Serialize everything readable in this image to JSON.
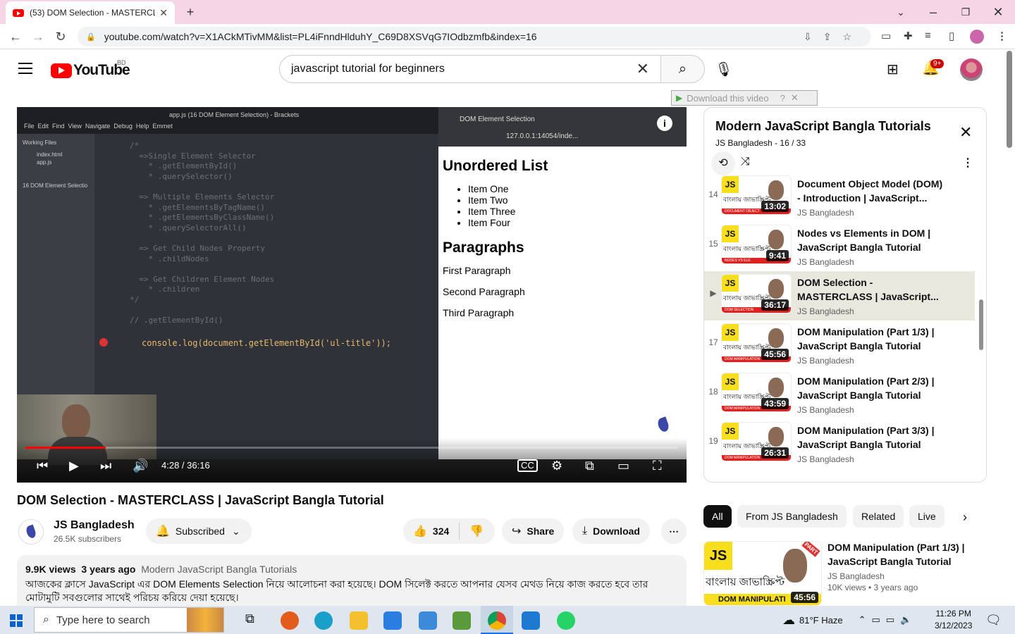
{
  "browser": {
    "tab_title": "(53) DOM Selection - MASTERCLASS | JavaScript Bangla Tutorial",
    "url": "youtube.com/watch?v=X1ACkMTivMM&list=PL4iFnndHlduhY_C69D8XSVqG7IOdbzmfb&index=16"
  },
  "header": {
    "logo_text": "YouTube",
    "country_code": "BD",
    "search_query": "javascript tutorial for beginners",
    "notification_count": "9+"
  },
  "extension": {
    "download_label": "Download this video"
  },
  "player": {
    "current_time": "4:28",
    "duration": "36:16",
    "time_display": "4:28 / 36:16",
    "progress_fraction": 0.123,
    "editor_title": "app.js (16 DOM Element Selection) - Brackets",
    "editor_menu": "File  Edit  Find  View  Navigate  Debug  Help  Emmet",
    "working_files": "Working Files",
    "file1": "index.html",
    "file2": "app.js",
    "project": "16 DOM Element Selectio",
    "code_comment": "/*\n  =>Single Element Selector\n    * .getElementById()\n    * .querySelector()\n\n  => Multiple Elements Selector\n    * .getElementsByTagName()\n    * .getElementsByClassName()\n    * .querySelectorAll()\n\n  => Get Child Nodes Property\n    * .childNodes\n\n  => Get Children Element Nodes\n    * .children\n*/\n\n// .getElementById()",
    "code_line": "console.log(document.getElementById('ul-title'));",
    "preview_tab": "DOM Element Selection",
    "preview_url": "127.0.0.1:14054/inde...",
    "preview": {
      "heading1": "Unordered List",
      "items": [
        "Item One",
        "Item Two",
        "Item Three",
        "Item Four"
      ],
      "heading2": "Paragraphs",
      "paragraphs": [
        "First Paragraph",
        "Second Paragraph",
        "Third Paragraph"
      ]
    }
  },
  "video": {
    "title": "DOM Selection - MASTERCLASS | JavaScript Bangla Tutorial",
    "channel": "JS Bangladesh",
    "subscribers": "26.5K subscribers",
    "subscribed_label": "Subscribed",
    "likes": "324",
    "share_label": "Share",
    "download_label": "Download",
    "views": "9.9K views",
    "age": "3 years ago",
    "playlist_link": "Modern JavaScript Bangla Tutorials",
    "description": "আজকের ক্লাসে JavaScript এর DOM Elements Selection নিয়ে আলোচনা করা হয়েছে। DOM সিলেক্ট করতে আপনার যেসব মেথড নিয়ে কাজ করতে হবে তার মোটামুটি সবগুলোর সাথেই পরিচয় করিয়ে দেয়া হয়েছে।"
  },
  "playlist": {
    "title": "Modern JavaScript Bangla Tutorials",
    "owner": "JS Bangladesh",
    "position": "16 / 33",
    "items": [
      {
        "index": "14",
        "title": "Document Object Model (DOM) - Introduction | JavaScript...",
        "channel": "JS Bangladesh",
        "duration": "13:02",
        "strip": "DOCUMENT OBJECT",
        "active": false
      },
      {
        "index": "15",
        "title": "Nodes vs Elements in DOM | JavaScript Bangla Tutorial",
        "channel": "JS Bangladesh",
        "duration": "9:41",
        "strip": "NODES VS ELE",
        "active": false
      },
      {
        "index": "▶",
        "title": "DOM Selection - MASTERCLASS | JavaScript...",
        "channel": "JS Bangladesh",
        "duration": "36:17",
        "strip": "DOM SELECTION",
        "active": true
      },
      {
        "index": "17",
        "title": "DOM Manipulation (Part 1/3) | JavaScript Bangla Tutorial",
        "channel": "JS Bangladesh",
        "duration": "45:56",
        "strip": "DOM MANIPULATION",
        "active": false
      },
      {
        "index": "18",
        "title": "DOM Manipulation (Part 2/3) | JavaScript Bangla Tutorial",
        "channel": "JS Bangladesh",
        "duration": "43:59",
        "strip": "DOM MANIPULATION",
        "active": false
      },
      {
        "index": "19",
        "title": "DOM Manipulation (Part 3/3) | JavaScript Bangla Tutorial",
        "channel": "JS Bangladesh",
        "duration": "26:31",
        "strip": "DOM MANIPULATION",
        "active": false
      }
    ],
    "thumb_js": "JS",
    "thumb_bangla": "বাংলায় জাভাস্ক্রিপ্ট"
  },
  "chips": [
    "All",
    "From JS Bangladesh",
    "Related",
    "Live"
  ],
  "related": {
    "title": "DOM Manipulation (Part 1/3) | JavaScript Bangla Tutorial",
    "channel": "JS Bangladesh",
    "views": "10K views",
    "age": "3 years ago",
    "meta": "10K views  • 3 years ago",
    "duration": "45:56",
    "strip": "DOM MANIPULATI",
    "part": "PART"
  },
  "taskbar": {
    "search_placeholder": "Type here to search",
    "weather": "81°F  Haze",
    "time": "11:26 PM",
    "date": "3/12/2023"
  },
  "colors": {
    "brand_red": "#ff0000",
    "js_yellow": "#f7df1e",
    "chip_active": "#0f0f0f"
  }
}
